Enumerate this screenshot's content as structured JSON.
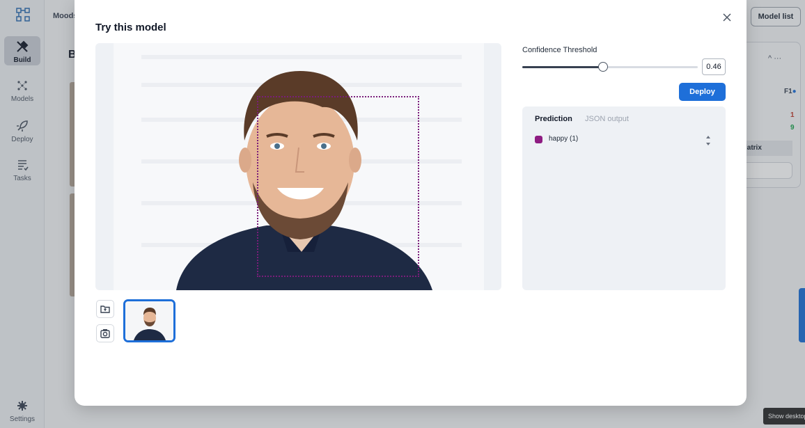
{
  "app": {
    "project_name": "Moods",
    "section_title_initial": "B",
    "model_list_label": "Model list",
    "nav": [
      {
        "label": "Build",
        "icon": "build-icon",
        "active": true
      },
      {
        "label": "Models",
        "icon": "models-icon",
        "active": false
      },
      {
        "label": "Deploy",
        "icon": "rocket-icon",
        "active": false
      },
      {
        "label": "Tasks",
        "icon": "tasks-icon",
        "active": false
      }
    ],
    "settings_label": "Settings",
    "right_panel": {
      "f1_label": "F1",
      "value_red": "1",
      "value_green": "9",
      "matrix_label": "latrix"
    },
    "show_desktop": "Show desktop"
  },
  "modal": {
    "title": "Try this model",
    "confidence": {
      "label": "Confidence Threshold",
      "value": "0.46",
      "fraction": 0.46
    },
    "deploy_label": "Deploy",
    "tabs": [
      {
        "label": "Prediction",
        "active": true
      },
      {
        "label": "JSON output",
        "active": false
      }
    ],
    "predictions": [
      {
        "label": "happy (1)",
        "color": "#8e1c82"
      }
    ]
  },
  "colors": {
    "accent": "#1e6fd9",
    "bbox": "#7a1d7a"
  }
}
